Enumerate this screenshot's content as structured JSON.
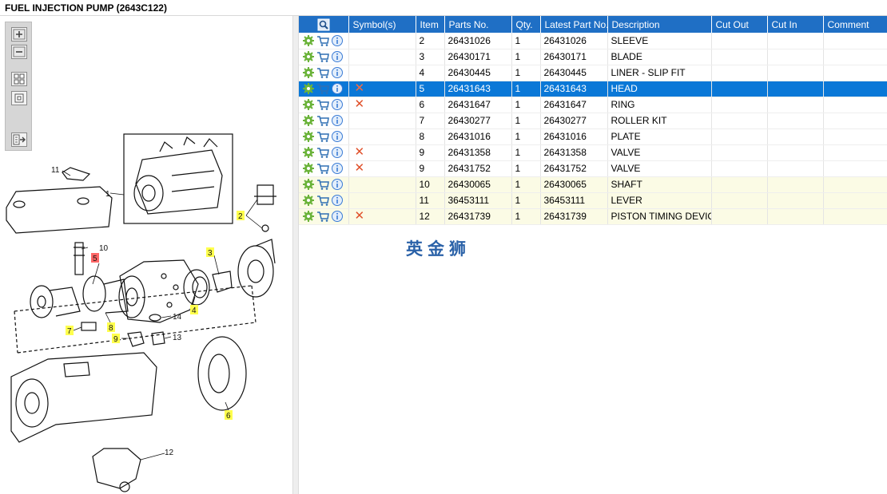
{
  "title": "FUEL INJECTION PUMP (2643C122)",
  "toolbar": {
    "buttons": [
      {
        "icon": "zoom-in-icon"
      },
      {
        "icon": "zoom-out-icon"
      },
      {
        "icon": "fit-all-icon"
      },
      {
        "icon": "actual-size-icon"
      },
      {
        "icon": "export-icon"
      }
    ]
  },
  "diagram": {
    "callouts": [
      "1",
      "2",
      "3",
      "4",
      "5",
      "6",
      "7",
      "8",
      "9",
      "10",
      "11",
      "12",
      "13",
      "14"
    ]
  },
  "grid": {
    "columns": [
      "",
      "Symbol(s)",
      "Item",
      "Parts No.",
      "Qty.",
      "Latest Part No.",
      "Description",
      "Cut Out",
      "Cut In",
      "Comment"
    ],
    "rows": [
      {
        "symbol": "",
        "item": "2",
        "part_no": "26431026",
        "qty": "1",
        "latest": "26431026",
        "desc": "SLEEVE",
        "cut_out": "",
        "cut_in": "",
        "comment": "",
        "style": ""
      },
      {
        "symbol": "",
        "item": "3",
        "part_no": "26430171",
        "qty": "1",
        "latest": "26430171",
        "desc": "BLADE",
        "cut_out": "",
        "cut_in": "",
        "comment": "",
        "style": ""
      },
      {
        "symbol": "",
        "item": "4",
        "part_no": "26430445",
        "qty": "1",
        "latest": "26430445",
        "desc": "LINER - SLIP FIT",
        "cut_out": "",
        "cut_in": "",
        "comment": "",
        "style": ""
      },
      {
        "symbol": "✕",
        "item": "5",
        "part_no": "26431643",
        "qty": "1",
        "latest": "26431643",
        "desc": "HEAD",
        "cut_out": "",
        "cut_in": "",
        "comment": "",
        "style": "sel"
      },
      {
        "symbol": "✕",
        "item": "6",
        "part_no": "26431647",
        "qty": "1",
        "latest": "26431647",
        "desc": "RING",
        "cut_out": "",
        "cut_in": "",
        "comment": "",
        "style": ""
      },
      {
        "symbol": "",
        "item": "7",
        "part_no": "26430277",
        "qty": "1",
        "latest": "26430277",
        "desc": "ROLLER KIT",
        "cut_out": "",
        "cut_in": "",
        "comment": "",
        "style": ""
      },
      {
        "symbol": "",
        "item": "8",
        "part_no": "26431016",
        "qty": "1",
        "latest": "26431016",
        "desc": "PLATE",
        "cut_out": "",
        "cut_in": "",
        "comment": "",
        "style": ""
      },
      {
        "symbol": "✕",
        "item": "9",
        "part_no": "26431358",
        "qty": "1",
        "latest": "26431358",
        "desc": "VALVE",
        "cut_out": "",
        "cut_in": "",
        "comment": "",
        "style": ""
      },
      {
        "symbol": "✕",
        "item": "9",
        "part_no": "26431752",
        "qty": "1",
        "latest": "26431752",
        "desc": "VALVE",
        "cut_out": "",
        "cut_in": "",
        "comment": "",
        "style": ""
      },
      {
        "symbol": "",
        "item": "10",
        "part_no": "26430065",
        "qty": "1",
        "latest": "26430065",
        "desc": "SHAFT",
        "cut_out": "",
        "cut_in": "",
        "comment": "",
        "style": "hl"
      },
      {
        "symbol": "",
        "item": "11",
        "part_no": "36453111",
        "qty": "1",
        "latest": "36453111",
        "desc": "LEVER",
        "cut_out": "",
        "cut_in": "",
        "comment": "",
        "style": "hl"
      },
      {
        "symbol": "✕",
        "item": "12",
        "part_no": "26431739",
        "qty": "1",
        "latest": "26431739",
        "desc": "PISTON TIMING DEVICE",
        "cut_out": "",
        "cut_in": "",
        "comment": "",
        "style": "hl"
      }
    ]
  },
  "watermark": "英金狮",
  "colors": {
    "header_blue": "#1f6fc5",
    "selected_row": "#0a78d7",
    "highlight_row": "#fbfbe5",
    "callout_yellow": "#ffff4d",
    "callout_red": "#ff6666",
    "delete_mark": "#e0502a"
  }
}
